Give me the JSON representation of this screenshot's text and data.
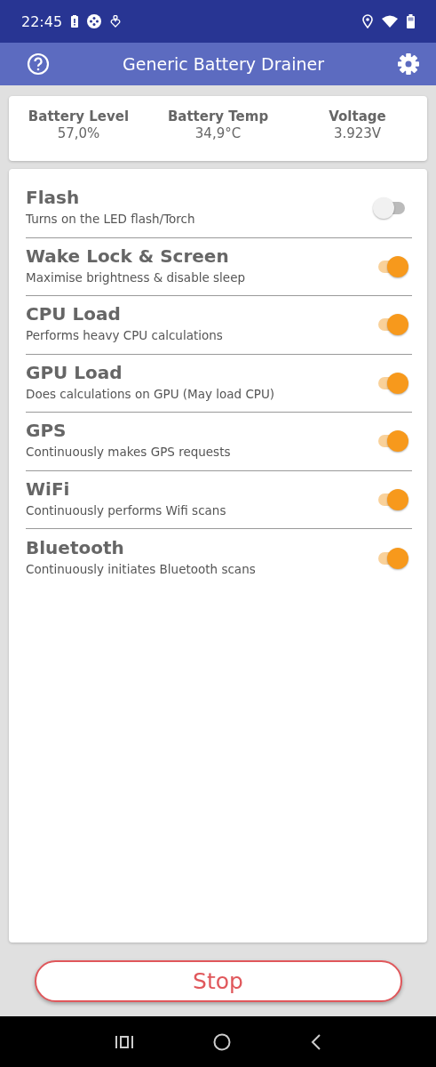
{
  "status_bar": {
    "time": "22:45"
  },
  "toolbar": {
    "title": "Generic Battery Drainer"
  },
  "stats": [
    {
      "label": "Battery Level",
      "value": "57,0%"
    },
    {
      "label": "Battery Temp",
      "value": "34,9°C"
    },
    {
      "label": "Voltage",
      "value": "3.923V"
    }
  ],
  "drains": [
    {
      "title": "Flash",
      "description": "Turns on the LED flash/Torch",
      "on": false
    },
    {
      "title": "Wake Lock & Screen",
      "description": "Maximise brightness & disable sleep",
      "on": true
    },
    {
      "title": "CPU Load",
      "description": "Performs heavy CPU calculations",
      "on": true
    },
    {
      "title": "GPU Load",
      "description": "Does calculations on GPU (May load CPU)",
      "on": true
    },
    {
      "title": "GPS",
      "description": "Continuously makes GPS requests",
      "on": true
    },
    {
      "title": "WiFi",
      "description": "Continuously performs Wifi scans",
      "on": true
    },
    {
      "title": "Bluetooth",
      "description": "Continuously initiates Bluetooth scans",
      "on": true
    }
  ],
  "stop_button": {
    "label": "Stop"
  }
}
